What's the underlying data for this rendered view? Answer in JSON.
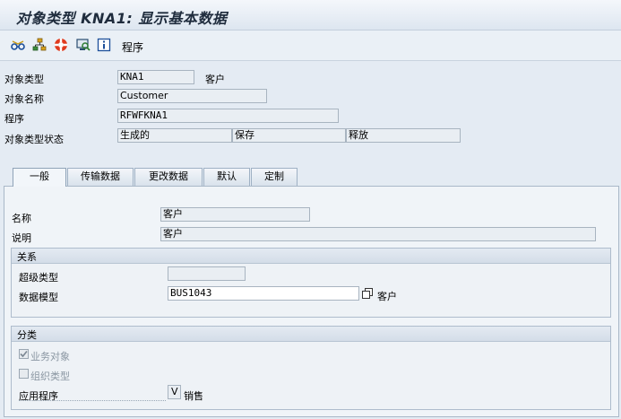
{
  "title": "对象类型 KNA1: 显示基本数据",
  "toolbar": {
    "icons": [
      "glasses-icon",
      "hierarchy-icon",
      "lifesaver-icon",
      "monitor-search-icon",
      "info-icon"
    ],
    "program_label": "程序"
  },
  "header": {
    "object_type_label": "对象类型",
    "object_type_value": "KNA1",
    "object_type_desc": "客户",
    "object_name_label": "对象名称",
    "object_name_value": "Customer",
    "program_label": "程序",
    "program_value": "RFWFKNA1",
    "status_label": "对象类型状态",
    "status_values": [
      "生成的",
      "保存",
      "释放"
    ]
  },
  "tabs": [
    {
      "label": "一般",
      "active": true
    },
    {
      "label": "传输数据",
      "active": false
    },
    {
      "label": "更改数据",
      "active": false
    },
    {
      "label": "默认",
      "active": false
    },
    {
      "label": "定制",
      "active": false
    }
  ],
  "general": {
    "name_label": "名称",
    "name_value": "客户",
    "desc_label": "说明",
    "desc_value": "客户",
    "relations": {
      "title": "关系",
      "supertype_label": "超级类型",
      "supertype_value": "",
      "datamodel_label": "数据模型",
      "datamodel_value": "BUS1043",
      "datamodel_desc": "客户"
    },
    "classification": {
      "title": "分类",
      "business_object_label": "业务对象",
      "business_object_checked": true,
      "org_type_label": "组织类型",
      "org_type_checked": false,
      "application_label": "应用程序",
      "application_value": "V",
      "application_desc": "销售"
    }
  }
}
